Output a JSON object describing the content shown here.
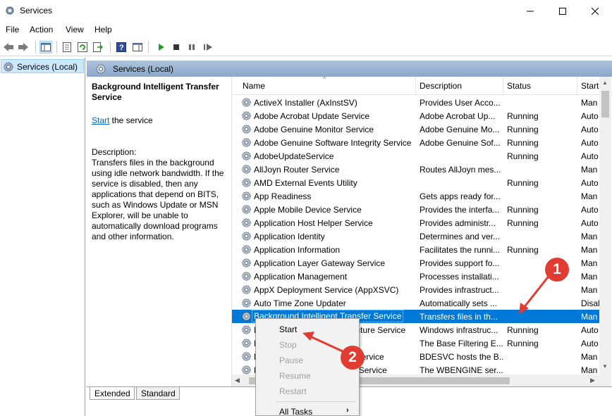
{
  "window": {
    "title": "Services",
    "minimize_icon": "minimize-icon",
    "maximize_icon": "maximize-icon",
    "close_icon": "close-icon"
  },
  "menu": [
    "File",
    "Action",
    "View",
    "Help"
  ],
  "toolbar_icons": [
    "back-arrow-icon",
    "forward-arrow-icon",
    "show-hide-console-tree-icon",
    "properties-icon",
    "refresh-icon",
    "export-list-icon",
    "help-icon",
    "show-hide-action-pane-icon",
    "start-service-icon",
    "stop-service-icon",
    "pause-service-icon",
    "restart-service-icon"
  ],
  "tree": {
    "item": "Services (Local)"
  },
  "main": {
    "header": "Services (Local)",
    "detail": {
      "title": "Background Intelligent Transfer Service",
      "start_link": "Start",
      "start_suffix": " the service",
      "description_label": "Description:",
      "description": "Transfers files in the background using idle network bandwidth. If the service is disabled, then any applications that depend on BITS, such as Windows Update or MSN Explorer, will be unable to automatically download programs and other information."
    },
    "columns": [
      "Name",
      "Description",
      "Status",
      "Start"
    ],
    "rows": [
      {
        "name": "ActiveX Installer (AxInstSV)",
        "desc": "Provides User Acco...",
        "status": "",
        "start": "Man"
      },
      {
        "name": "Adobe Acrobat Update Service",
        "desc": "Adobe Acrobat Up...",
        "status": "Running",
        "start": "Auto"
      },
      {
        "name": "Adobe Genuine Monitor Service",
        "desc": "Adobe Genuine Mo...",
        "status": "Running",
        "start": "Auto"
      },
      {
        "name": "Adobe Genuine Software Integrity Service",
        "desc": "Adobe Genuine Sof...",
        "status": "Running",
        "start": "Auto"
      },
      {
        "name": "AdobeUpdateService",
        "desc": "",
        "status": "Running",
        "start": "Auto"
      },
      {
        "name": "AllJoyn Router Service",
        "desc": "Routes AllJoyn mes...",
        "status": "",
        "start": "Man"
      },
      {
        "name": "AMD External Events Utility",
        "desc": "",
        "status": "Running",
        "start": "Auto"
      },
      {
        "name": "App Readiness",
        "desc": "Gets apps ready for...",
        "status": "",
        "start": "Man"
      },
      {
        "name": "Apple Mobile Device Service",
        "desc": "Provides the interfa...",
        "status": "Running",
        "start": "Auto"
      },
      {
        "name": "Application Host Helper Service",
        "desc": "Provides administr...",
        "status": "Running",
        "start": "Auto"
      },
      {
        "name": "Application Identity",
        "desc": "Determines and ver...",
        "status": "",
        "start": "Man"
      },
      {
        "name": "Application Information",
        "desc": "Facilitates the runni...",
        "status": "Running",
        "start": "Man"
      },
      {
        "name": "Application Layer Gateway Service",
        "desc": "Provides support fo...",
        "status": "",
        "start": "Man"
      },
      {
        "name": "Application Management",
        "desc": "Processes installati...",
        "status": "",
        "start": "Man"
      },
      {
        "name": "AppX Deployment Service (AppXSVC)",
        "desc": "Provides infrastruct...",
        "status": "",
        "start": "Man"
      },
      {
        "name": "Auto Time Zone Updater",
        "desc": "Automatically sets ...",
        "status": "",
        "start": "Disal"
      },
      {
        "name": "Background Intelligent Transfer Service",
        "desc": "Transfers files in th...",
        "status": "",
        "start": "Man"
      },
      {
        "name": "Background Tasks Infrastructure Service",
        "desc": "Windows infrastruc...",
        "status": "Running",
        "start": "Auto"
      },
      {
        "name": "Base Filtering Engine",
        "desc": "The Base Filtering E...",
        "status": "Running",
        "start": "Auto"
      },
      {
        "name": "BitLocker Drive Encryption Service",
        "desc": "BDESVC hosts the B...",
        "status": "",
        "start": "Man"
      },
      {
        "name": "Block Level Backup Engine Service",
        "desc": "The WBENGINE ser...",
        "status": "",
        "start": "Man"
      }
    ],
    "selected_row": 16
  },
  "tabs": [
    "Extended",
    "Standard"
  ],
  "context_menu": {
    "items": [
      {
        "label": "Start",
        "enabled": true
      },
      {
        "label": "Stop",
        "enabled": false
      },
      {
        "label": "Pause",
        "enabled": false
      },
      {
        "label": "Resume",
        "enabled": false
      },
      {
        "label": "Restart",
        "enabled": false
      },
      {
        "label": "All Tasks",
        "enabled": true,
        "submenu": true
      }
    ]
  },
  "annotations": [
    {
      "number": "1",
      "color": "#e03c31"
    },
    {
      "number": "2",
      "color": "#e03c31"
    }
  ]
}
